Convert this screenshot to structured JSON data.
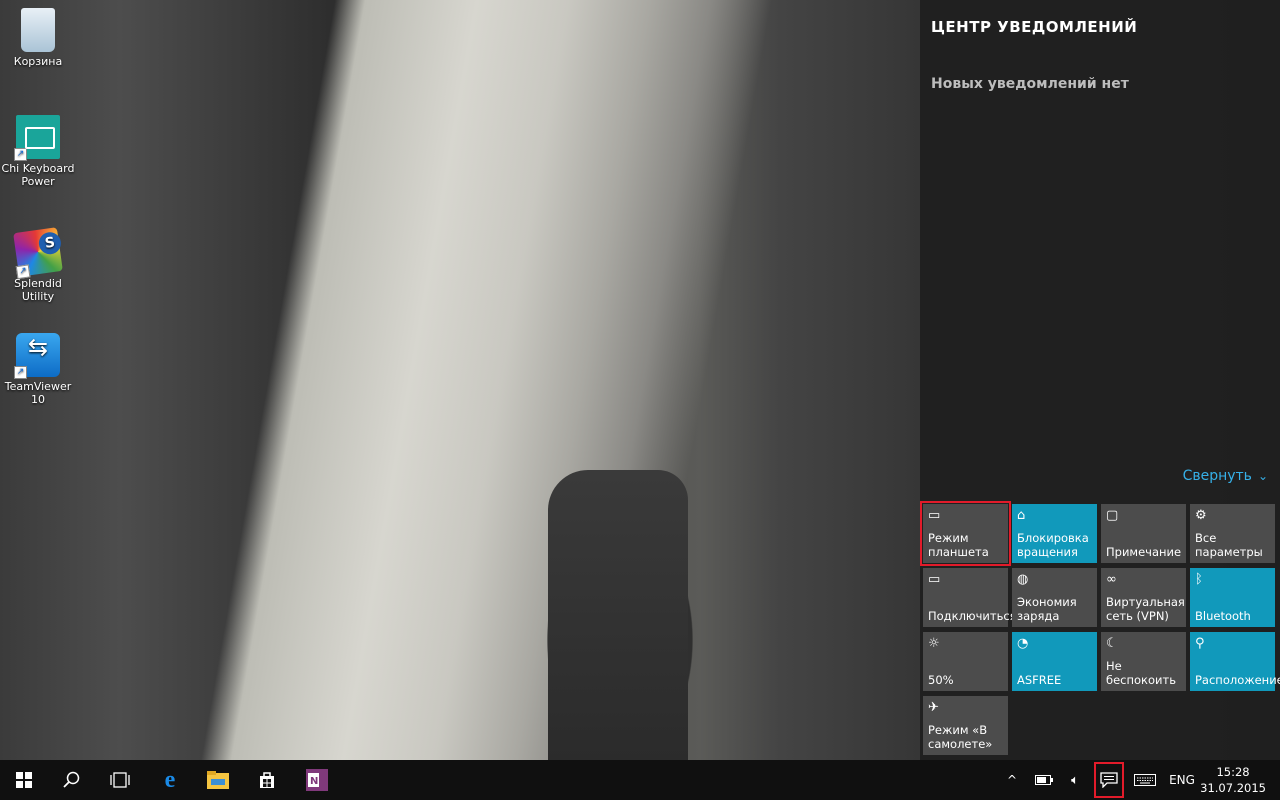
{
  "desktop": {
    "icons": [
      {
        "label": "Корзина"
      },
      {
        "label": "Chi Keyboard Power"
      },
      {
        "label": "Splendid Utility"
      },
      {
        "label": "TeamViewer 10"
      }
    ]
  },
  "action_center": {
    "title": "ЦЕНТР УВЕДОМЛЕНИЙ",
    "empty_text": "Новых уведомлений нет",
    "collapse_label": "Свернуть",
    "tiles": [
      {
        "label": "Режим планшета",
        "icon": "tablet-mode-icon",
        "active": false,
        "selected": true
      },
      {
        "label": "Блокировка вращения",
        "icon": "rotation-lock-icon",
        "active": true
      },
      {
        "label": "Примечание",
        "icon": "note-icon",
        "active": false
      },
      {
        "label": "Все параметры",
        "icon": "settings-icon",
        "active": false
      },
      {
        "label": "Подключиться",
        "icon": "connect-icon",
        "active": false
      },
      {
        "label": "Экономия заряда",
        "icon": "battery-saver-icon",
        "active": false
      },
      {
        "label": "Виртуальная сеть (VPN)",
        "icon": "vpn-icon",
        "active": false
      },
      {
        "label": "Bluetooth",
        "icon": "bluetooth-icon",
        "active": true
      },
      {
        "label": "50%",
        "icon": "brightness-icon",
        "active": false
      },
      {
        "label": "ASFREE",
        "icon": "wifi-icon",
        "active": true
      },
      {
        "label": "Не беспокоить",
        "icon": "quiet-hours-icon",
        "active": false
      },
      {
        "label": "Расположение",
        "icon": "location-icon",
        "active": true
      },
      {
        "label": "Режим «В самолете»",
        "icon": "airplane-icon",
        "active": false
      }
    ]
  },
  "taskbar": {
    "language": "ENG",
    "time": "15:28",
    "date": "31.07.2015"
  },
  "colors": {
    "accent": "#1199bb",
    "tile": "#4c4c4c",
    "link": "#36b0e8",
    "highlight": "#e21b2a"
  }
}
